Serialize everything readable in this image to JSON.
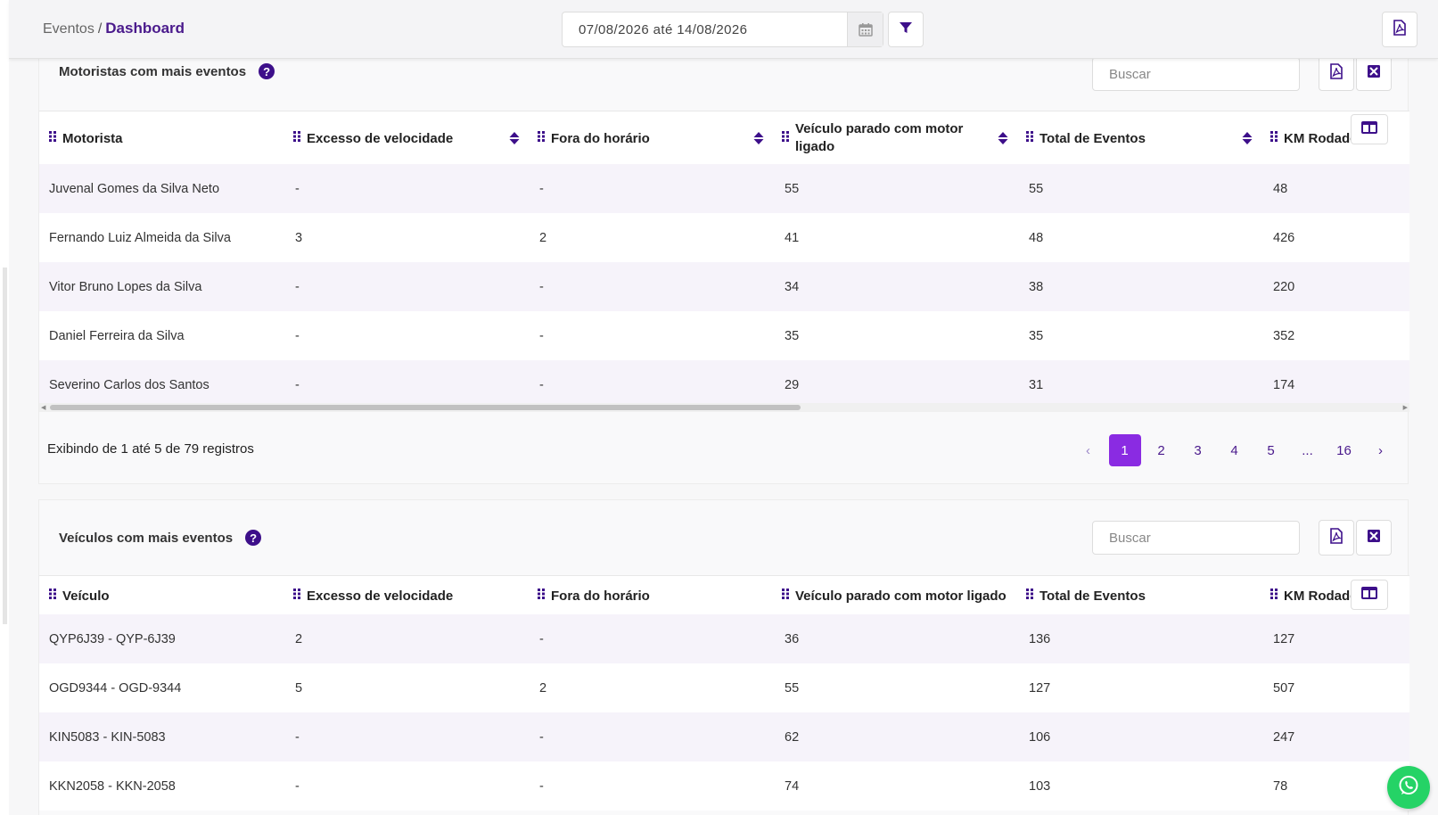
{
  "breadcrumb": {
    "parent": "Eventos",
    "separator": "/",
    "current": "Dashboard"
  },
  "date_range": {
    "start": "07/08/2026",
    "connector": "até",
    "end": "14/08/2026"
  },
  "colors": {
    "accent": "#4a1a8c",
    "active_page": "#8a2be2",
    "whatsapp": "#25d366"
  },
  "drivers_table": {
    "title": "Motoristas com mais eventos",
    "search_placeholder": "Buscar",
    "columns": [
      "Motorista",
      "Excesso de velocidade",
      "Fora do horário",
      "Veículo parado com motor ligado",
      "Total de Eventos",
      "KM Rodado"
    ],
    "rows": [
      [
        "Juvenal Gomes da Silva Neto",
        "-",
        "-",
        "55",
        "55",
        "48"
      ],
      [
        "Fernando Luiz Almeida da Silva",
        "3",
        "2",
        "41",
        "48",
        "426"
      ],
      [
        "Vitor Bruno Lopes da Silva",
        "-",
        "-",
        "34",
        "38",
        "220"
      ],
      [
        "Daniel Ferreira da Silva",
        "-",
        "-",
        "35",
        "35",
        "352"
      ],
      [
        "Severino Carlos dos Santos",
        "-",
        "-",
        "29",
        "31",
        "174"
      ]
    ],
    "info": "Exibindo de 1 até 5 de 79 registros",
    "pagination": {
      "prev": "‹",
      "pages": [
        "1",
        "2",
        "3",
        "4",
        "5",
        "...",
        "16"
      ],
      "active": "1",
      "next": "›"
    }
  },
  "vehicles_table": {
    "title": "Veículos com mais eventos",
    "search_placeholder": "Buscar",
    "columns": [
      "Veículo",
      "Excesso de velocidade",
      "Fora do horário",
      "Veículo parado com motor ligado",
      "Total de Eventos",
      "KM Rodado"
    ],
    "rows": [
      [
        "QYP6J39 - QYP-6J39",
        "2",
        "-",
        "36",
        "136",
        "127"
      ],
      [
        "OGD9344 - OGD-9344",
        "5",
        "2",
        "55",
        "127",
        "507"
      ],
      [
        "KIN5083 - KIN-5083",
        "-",
        "-",
        "62",
        "106",
        "247"
      ],
      [
        "KKN2058 - KKN-2058",
        "-",
        "-",
        "74",
        "103",
        "78"
      ]
    ]
  }
}
